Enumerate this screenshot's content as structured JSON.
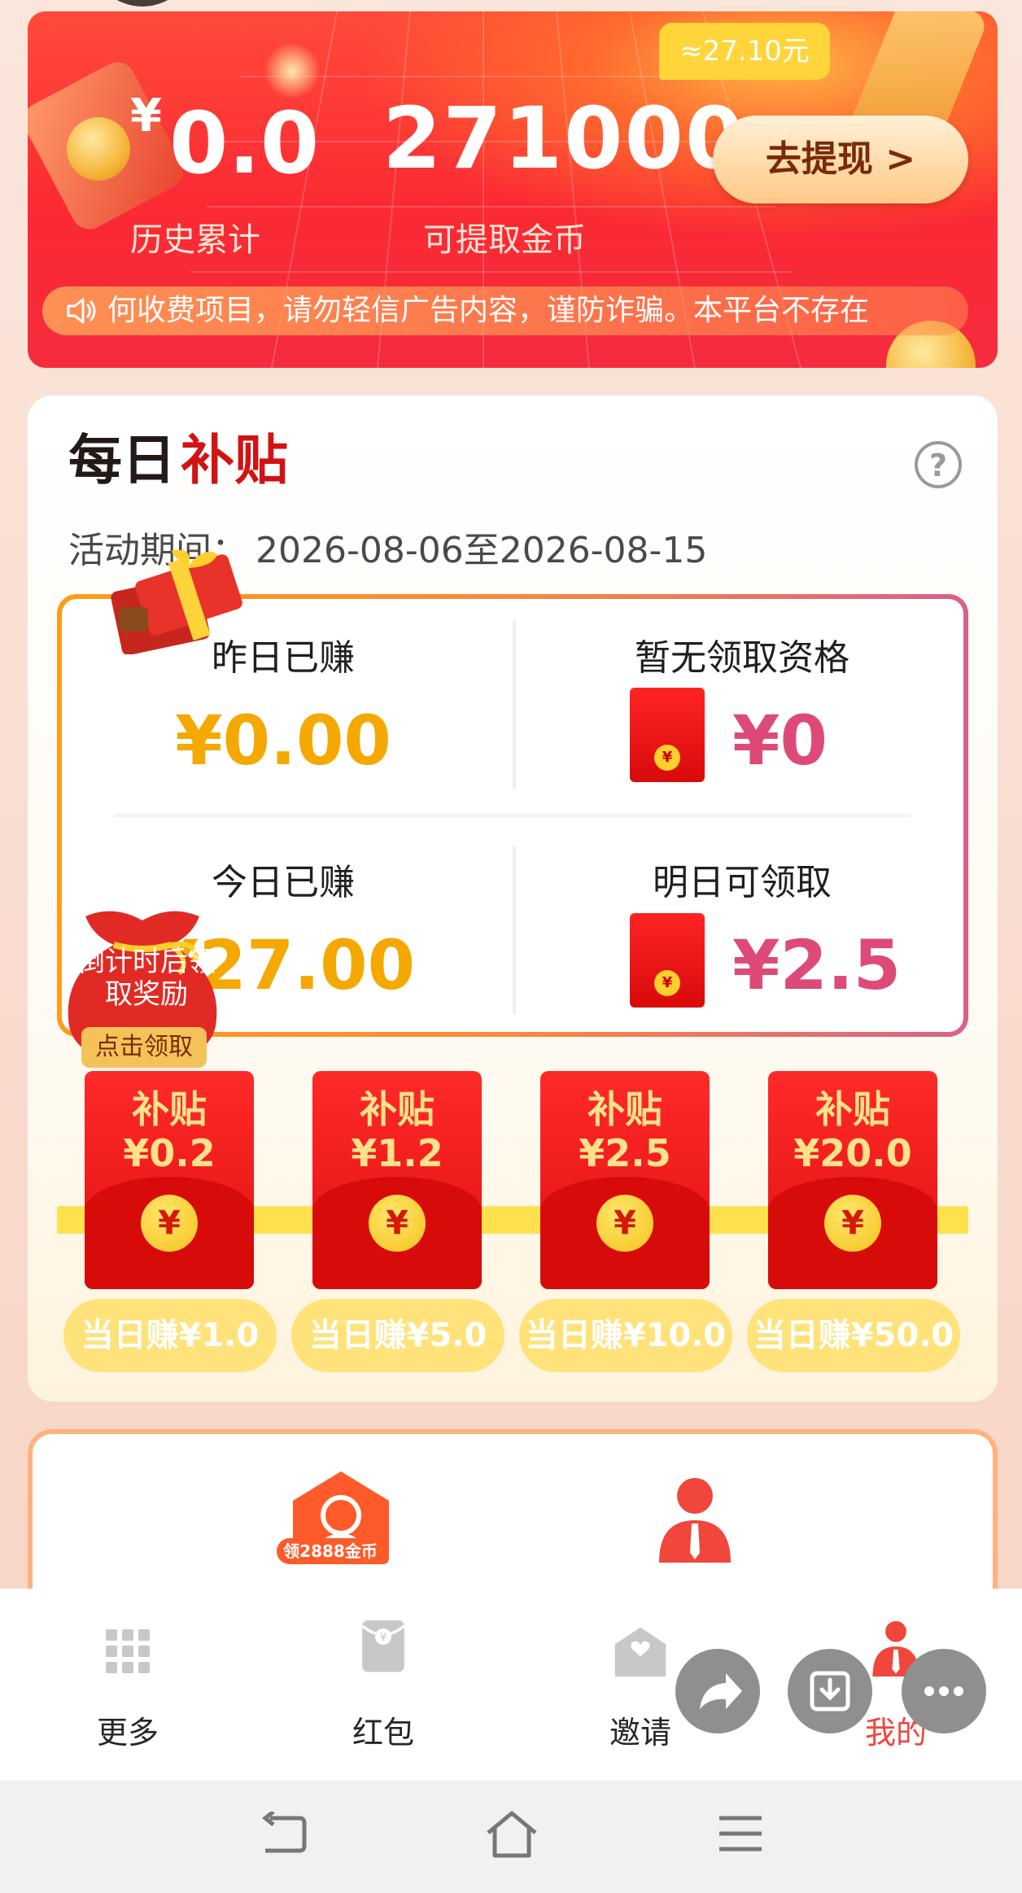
{
  "banner": {
    "approx_label": "≈27.10元",
    "currency": "¥",
    "history_total": "0.0",
    "history_label": "历史累计",
    "coins": "271000",
    "coins_label": "可提取金币",
    "withdraw_label": "去提现 >",
    "notice": "何收费项目，请勿轻信广告内容，谨防诈骗。本平台不存在"
  },
  "subsidy": {
    "title_part1": "每日",
    "title_part2": "补贴",
    "help": "?",
    "period_label": "活动期间：",
    "period_value": "2026-08-06至2026-08-15",
    "yesterday_label": "昨日已赚",
    "yesterday_value": "¥0.00",
    "eligibility_label": "暂无领取资格",
    "eligibility_value": "¥0",
    "today_label": "今日已赚",
    "today_value": "¥27.00",
    "tomorrow_label": "明日可领取",
    "tomorrow_value": "¥2.5",
    "bag_text": "倒计时后领取奖励",
    "bag_button": "点击领取",
    "mini_coin": "¥",
    "tiers": [
      {
        "label": "补贴",
        "amount": "¥0.2",
        "coin": "¥",
        "condition": "当日赚¥1.0"
      },
      {
        "label": "补贴",
        "amount": "¥1.2",
        "coin": "¥",
        "condition": "当日赚¥5.0"
      },
      {
        "label": "补贴",
        "amount": "¥2.5",
        "coin": "¥",
        "condition": "当日赚¥10.0"
      },
      {
        "label": "补贴",
        "amount": "¥20.0",
        "coin": "¥",
        "condition": "当日赚¥50.0"
      }
    ]
  },
  "services": {
    "badge": "领2888金币"
  },
  "nav": {
    "items": [
      {
        "label": "更多",
        "icon": "grid-icon"
      },
      {
        "label": "红包",
        "icon": "red-packet-icon"
      },
      {
        "label": "邀请",
        "icon": "invite-icon"
      },
      {
        "label": "我的",
        "icon": "profile-icon",
        "active": true
      }
    ],
    "active_color": "#f0463c"
  },
  "colors": {
    "accent_red": "#d11313",
    "gold": "#f5a800",
    "pink": "#de4a77"
  }
}
